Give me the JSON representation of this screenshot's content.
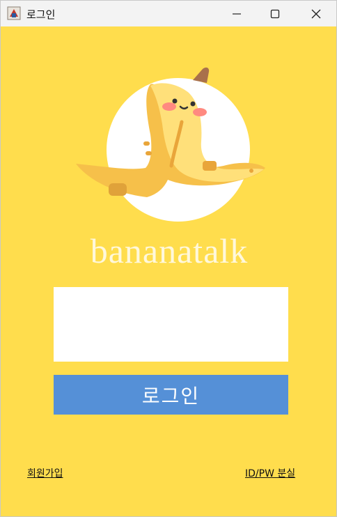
{
  "window": {
    "title": "로그인",
    "icons": {
      "app": "java-app-icon",
      "minimize": "minimize-icon",
      "maximize": "maximize-icon",
      "close": "close-icon"
    }
  },
  "logo": {
    "icon": "banana-mascot-logo"
  },
  "brand": {
    "name": "bananatalk"
  },
  "login": {
    "id_value": "",
    "button_label": "로그인"
  },
  "links": {
    "signup": "회원가입",
    "find_idpw": "ID/PW 분실"
  },
  "colors": {
    "background": "#ffdd4d",
    "button": "#5590d7",
    "titlebar": "#f3f3f3"
  }
}
